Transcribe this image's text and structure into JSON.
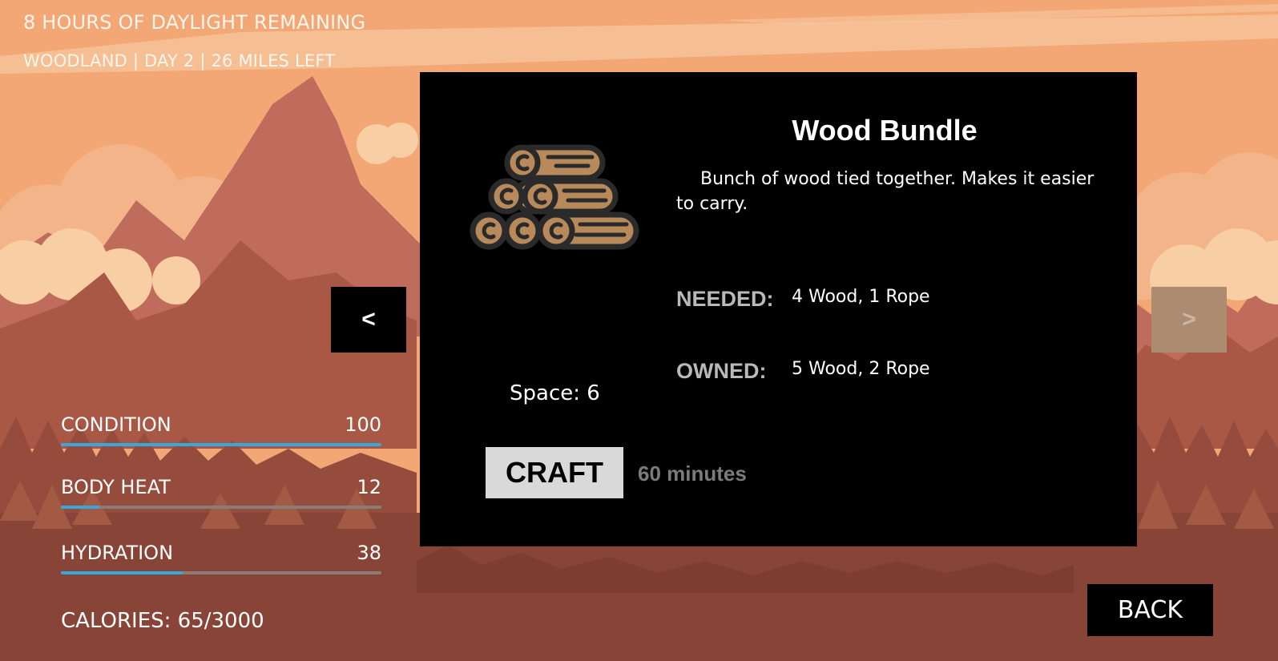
{
  "hud": {
    "daylight": "8 HOURS OF DAYLIGHT REMAINING",
    "location": "WOODLAND | DAY 2 | 26 MILES LEFT"
  },
  "stats": [
    {
      "name": "CONDITION",
      "value": "100",
      "fraction": 1.0
    },
    {
      "name": "BODY HEAT",
      "value": "12",
      "fraction": 0.12
    },
    {
      "name": "HYDRATION",
      "value": "38",
      "fraction": 0.38
    }
  ],
  "calories": "CALORIES: 65/3000",
  "item": {
    "title": "Wood Bundle",
    "description": "Bunch of wood tied together. Makes it easier to carry.",
    "icon": "log-bundle-icon",
    "needed_label": "NEEDED:",
    "needed": "4 Wood, 1 Rope",
    "owned_label": "OWNED:",
    "owned": "5 Wood, 2 Rope",
    "space": "Space: 6",
    "craft_label": "CRAFT",
    "craft_time": "60 minutes"
  },
  "nav": {
    "prev": "<",
    "next": ">"
  },
  "back_label": "BACK",
  "colors": {
    "sky": "#f2a775",
    "mountain": "#bf6c5c",
    "ground": "#884537",
    "bar_fill": "#38a8dc",
    "panel": "#000000",
    "disabled_nav": "#ad8b70"
  }
}
